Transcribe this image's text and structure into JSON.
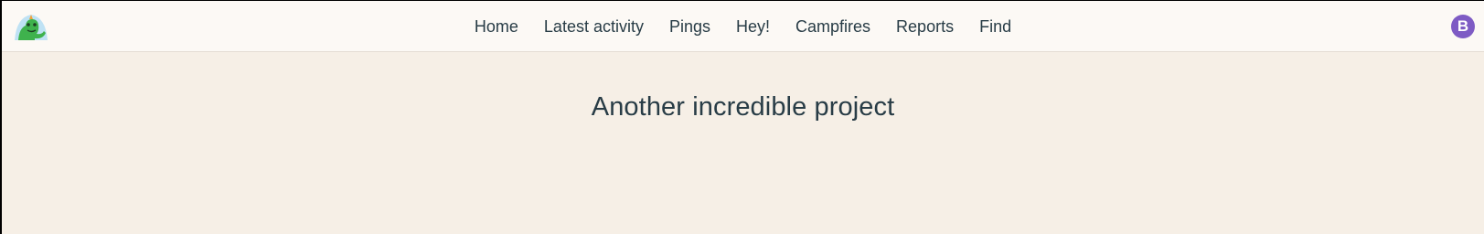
{
  "app": {
    "logo_icon": "basecamp-logo-icon"
  },
  "nav": {
    "items": [
      {
        "label": "Home"
      },
      {
        "label": "Latest activity"
      },
      {
        "label": "Pings"
      },
      {
        "label": "Hey!"
      },
      {
        "label": "Campfires"
      },
      {
        "label": "Reports"
      },
      {
        "label": "Find"
      }
    ]
  },
  "user": {
    "avatar_initial": "B",
    "avatar_color": "#7e5bc4"
  },
  "main": {
    "project_title": "Another incredible project"
  },
  "colors": {
    "page_background": "#f6efe6",
    "topbar_background": "#fcf9f5",
    "text": "#283c46"
  }
}
